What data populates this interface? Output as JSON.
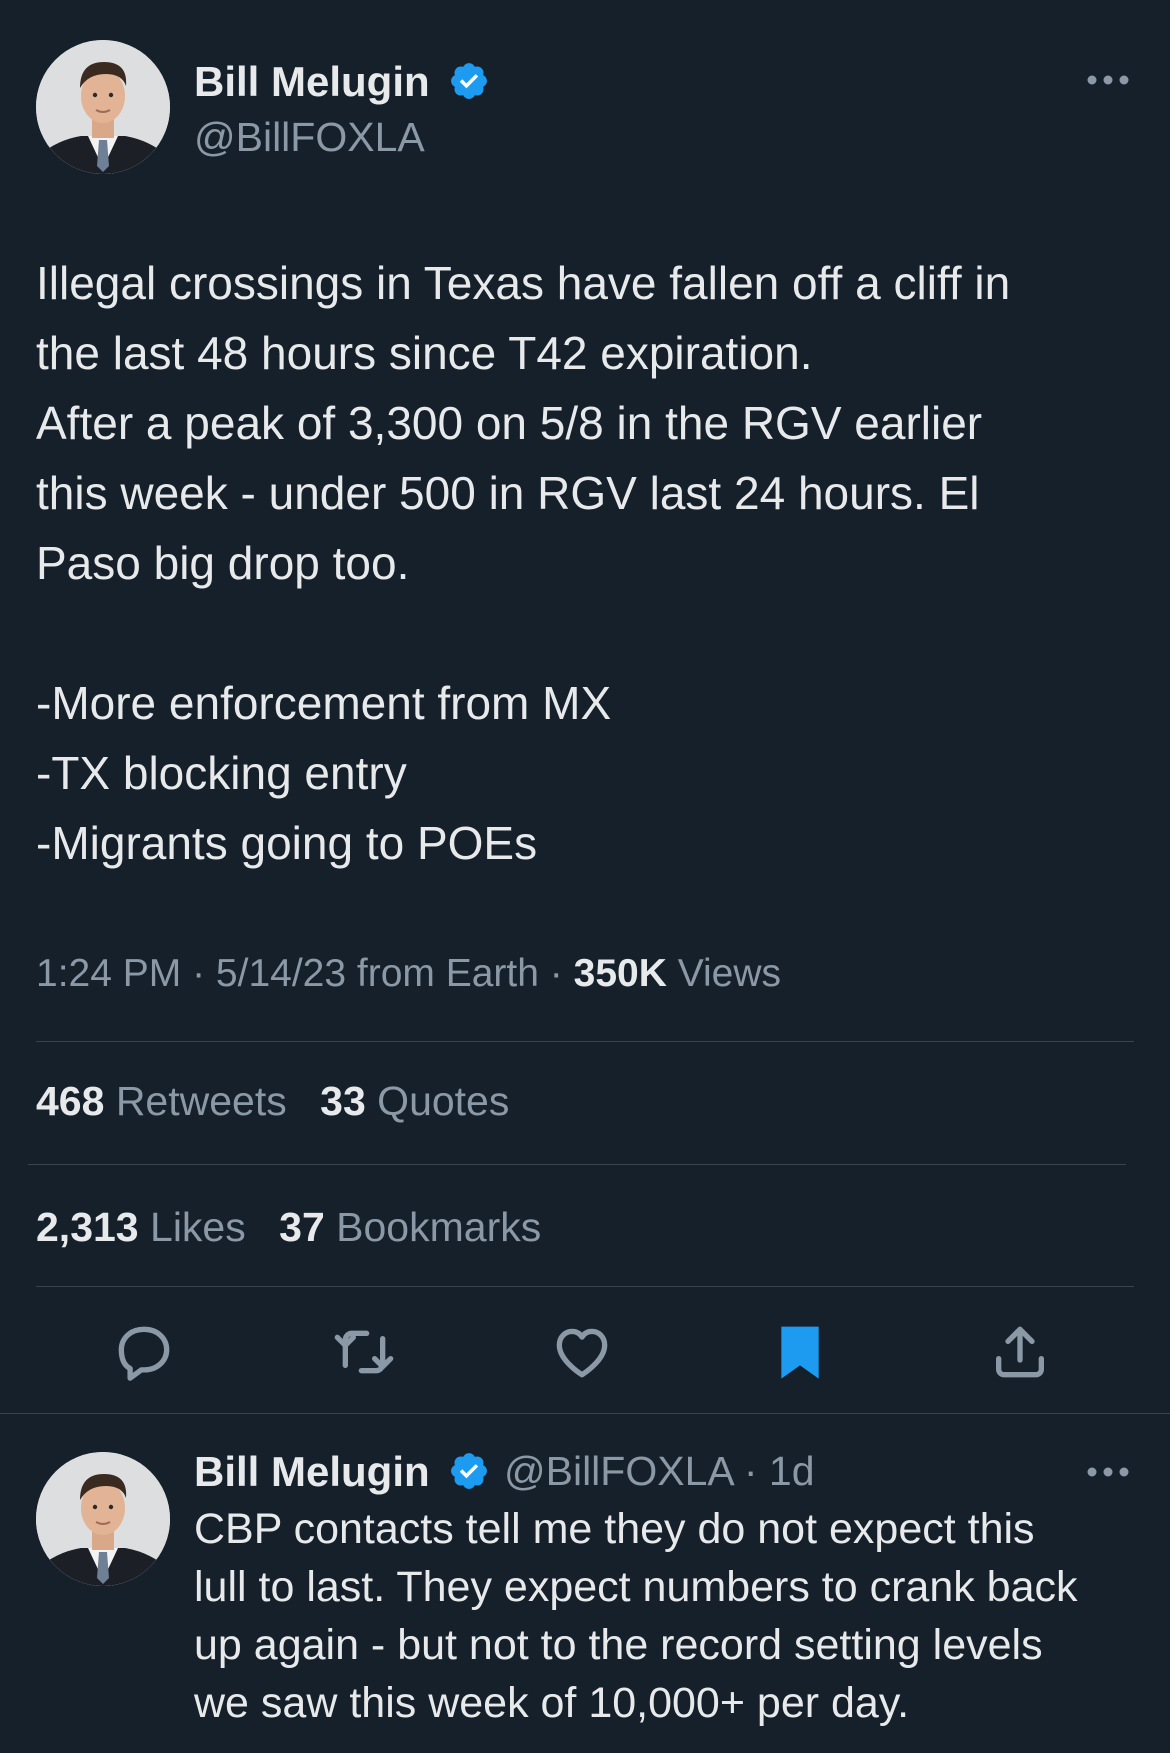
{
  "main_tweet": {
    "author": {
      "name": "Bill Melugin",
      "handle": "@BillFOXLA",
      "verified": true
    },
    "text_lines": [
      "Illegal crossings in Texas have fallen off a cliff in",
      "the last 48 hours since T42 expiration.",
      "After a peak of 3,300 on 5/8 in the RGV earlier",
      "this week - under 500 in RGV last 24 hours. El",
      "Paso big drop too.",
      "",
      "-More enforcement from MX",
      "-TX blocking entry",
      "-Migrants going to POEs"
    ],
    "time": "1:24 PM",
    "date": "5/14/23",
    "source": "from Earth",
    "views_count": "350K",
    "views_label": "Views",
    "separator": "·",
    "stats": {
      "retweets_count": "468",
      "retweets_label": "Retweets",
      "quotes_count": "33",
      "quotes_label": "Quotes",
      "likes_count": "2,313",
      "likes_label": "Likes",
      "bookmarks_count": "37",
      "bookmarks_label": "Bookmarks"
    },
    "actions": [
      "reply-icon",
      "retweet-icon",
      "like-icon",
      "bookmark-icon",
      "share-icon"
    ],
    "bookmarked": true
  },
  "reply_tweet": {
    "author": {
      "name": "Bill Melugin",
      "handle": "@BillFOXLA",
      "verified": true
    },
    "age": "1d",
    "separator": "·",
    "text_lines": [
      "CBP contacts tell me they do not expect this",
      "lull to last. They expect numbers to crank back",
      "up again - but not to the record setting levels",
      "we saw this week of 10,000+ per day."
    ]
  },
  "colors": {
    "background": "#15202b",
    "text_primary": "#e7e9ea",
    "text_secondary": "#8b98a5",
    "accent_blue": "#1d9bf0",
    "divider": "#38444d"
  }
}
